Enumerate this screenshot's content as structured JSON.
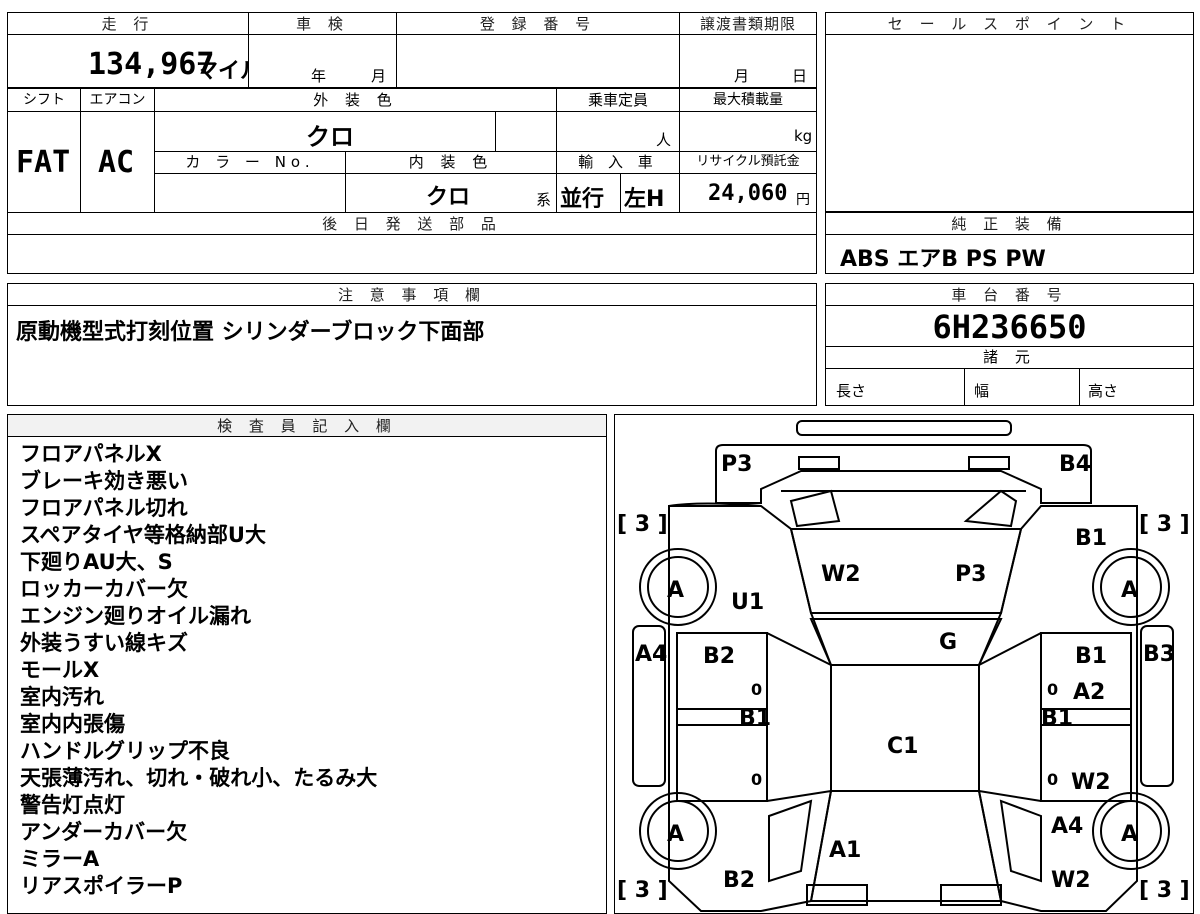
{
  "top_row": {
    "mileage_header": "走 行",
    "mileage_value": "134,967",
    "mileage_unit": "マイル",
    "shaken_header": "車 検",
    "shaken_year": "年",
    "shaken_month": "月",
    "reg_header": "登 録 番 号",
    "transfer_header": "譲渡書類期限",
    "transfer_month": "月",
    "transfer_day": "日",
    "sales_point_header": "セ ー ル ス ポ イ ン ト"
  },
  "second_row": {
    "shift_header": "シフト",
    "shift_value": "FAT",
    "ac_header": "エアコン",
    "ac_value": "AC",
    "ext_color_header": "外 装 色",
    "ext_color_value": "クロ",
    "capacity_header": "乗車定員",
    "capacity_unit": "人",
    "max_load_header": "最大積載量",
    "max_load_unit": "kg",
    "color_no_header": "カ ラ ー No.",
    "int_color_header": "内 装 色",
    "int_color_value": "クロ",
    "int_color_suffix": "系",
    "import_header": "輸 入 車",
    "import_value1": "並行",
    "import_value2": "左H",
    "recycle_header": "リサイクル預託金",
    "recycle_value": "24,060",
    "recycle_unit": "円"
  },
  "later_parts_header": "後 日 発 送 部 品",
  "genuine_equipment": {
    "header": "純 正 装 備",
    "value": "ABS エアB PS PW"
  },
  "caution": {
    "header": "注 意 事 項 欄",
    "text": "原動機型式打刻位置 シリンダーブロック下面部"
  },
  "chassis": {
    "header": "車 台 番 号",
    "value": "6H236650",
    "spec_header": "諸 元",
    "length_label": "長さ",
    "width_label": "幅",
    "height_label": "高さ"
  },
  "inspector": {
    "header": "検 査 員 記 入 欄",
    "notes": [
      "フロアパネルX",
      "ブレーキ効き悪い",
      "フロアパネル切れ",
      "スペアタイヤ等格納部U大",
      "下廻りAU大、S",
      "ロッカーカバー欠",
      "エンジン廻りオイル漏れ",
      "外装うすい線キズ",
      "モールX",
      "室内汚れ",
      "室内内張傷",
      "ハンドルグリップ不良",
      "天張薄汚れ、切れ・破れ小、たるみ大",
      "警告灯点灯",
      "アンダーカバー欠",
      "ミラーA",
      "リアスポイラーP"
    ]
  },
  "diagram": {
    "labels": {
      "rear_left": "P3",
      "rear_right": "B4",
      "tread_fl": "[ 3 ]",
      "tread_fr": "[ 3 ]",
      "tread_rl": "[ 3 ]",
      "tread_rr": "[ 3 ]",
      "tire_fl": "A",
      "tire_fr": "A",
      "tire_rl": "A",
      "tire_rr": "A",
      "quarter_left": "U1",
      "quarter_right": "B1",
      "rear_glass_left": "W2",
      "rear_glass_right": "P3",
      "rear_side_left": "A4",
      "rear_side_right": "B3",
      "door_rl": "B2",
      "door_rr": "B1",
      "door_rr_lower": "A2",
      "pillar_left": "B1",
      "pillar_right": "B1",
      "roof": "G",
      "cabin": "C1",
      "door_fr_window": "W2",
      "front_right_side": "A4",
      "hood": "A1",
      "front_left": "B2",
      "front_right": "W2",
      "zero": "0"
    }
  }
}
